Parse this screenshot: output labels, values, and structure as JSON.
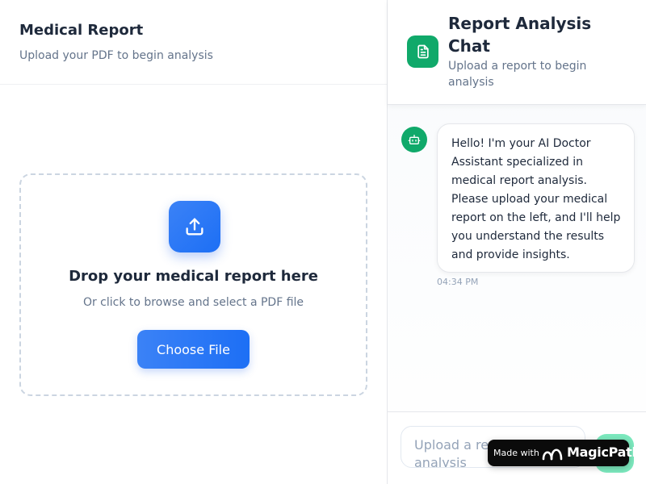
{
  "left_panel": {
    "title": "Medical Report",
    "subtitle": "Upload your PDF to begin analysis",
    "dropzone": {
      "icon": "upload-icon",
      "title": "Drop your medical report here",
      "subtitle": "Or click to browse and select a PDF file",
      "button_label": "Choose File"
    }
  },
  "chat_panel": {
    "icon": "document-icon",
    "title": "Report Analysis Chat",
    "subtitle": "Upload a report to begin analysis",
    "messages": [
      {
        "sender_icon": "robot-icon",
        "text": "Hello! I'm your AI Doctor Assistant specialized in medical report analysis. Please upload your medical report on the left, and I'll help you understand the results and provide insights.",
        "time": "04:34 PM"
      }
    ],
    "input": {
      "placeholder": "Upload a report to start analysis"
    },
    "send_icon": "send-icon"
  },
  "badge": {
    "made_with": "Made with",
    "brand": "MagicPath",
    "icon": "magicpath-logo"
  },
  "colors": {
    "primary_blue": "#2563eb",
    "accent_green": "#10a96a",
    "send_green": "#6ee7b7",
    "text_dark": "#1e293b",
    "text_muted": "#64748b"
  }
}
